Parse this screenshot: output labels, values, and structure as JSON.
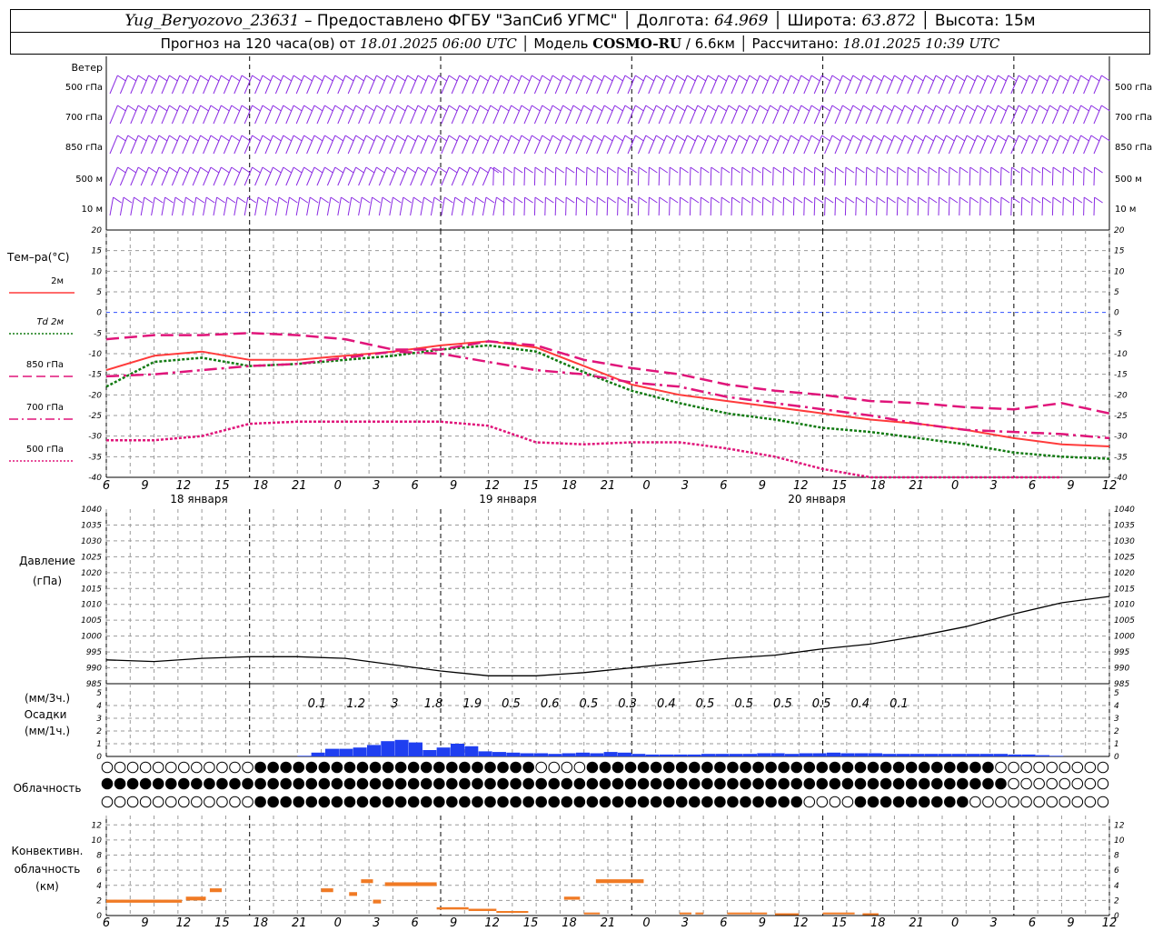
{
  "header": {
    "station": "Yug_Beryozovo_23631",
    "dash": " – Предоставлено ФГБУ \"ЗапСиб УГМС\" │ Долгота: ",
    "lon": "64.969",
    "lat_label": " │ Широта: ",
    "lat": "63.872",
    "alt_label": " │ Высота: 15м",
    "forecast_label": "Прогноз на 120 часа(ов) от ",
    "forecast_from": "18.01.2025 06:00 UTC",
    "model_label": "  │ Модель ",
    "model": "COSMO-RU",
    "res": " / 6.6км │ Рассчитано: ",
    "calc": "18.01.2025 10:39 UTC"
  },
  "time_axis": {
    "tick_labels": [
      "6",
      "9",
      "12",
      "15",
      "18",
      "21",
      "0",
      "3",
      "6",
      "9",
      "12",
      "15",
      "18",
      "21",
      "0",
      "3",
      "6",
      "9",
      "12",
      "15",
      "18",
      "21",
      "0",
      "3",
      "6",
      "9",
      "12"
    ],
    "day_labels": [
      "18 января",
      "19 января",
      "20 января"
    ]
  },
  "wind_panel": {
    "title": "Ветер",
    "levels": [
      "500 гПа",
      "700 гПа",
      "850 гПа",
      "500 м",
      "10  м"
    ],
    "color": "#8a2be2"
  },
  "temp_panel": {
    "title": "Тем–ра(°C)",
    "legend": [
      {
        "label": "2м",
        "color": "#ff3b3b",
        "style": "solid"
      },
      {
        "label": "Td  2м",
        "color": "#117a11",
        "style": "dotted"
      },
      {
        "label": "850 гПа",
        "color": "#e0157a",
        "style": "dash"
      },
      {
        "label": "700 гПа",
        "color": "#e0157a",
        "style": "dashdot"
      },
      {
        "label": "500 гПа",
        "color": "#e0157a",
        "style": "dotted"
      }
    ],
    "y_ticks": [
      "20",
      "15",
      "10",
      "5",
      "0",
      "-5",
      "-10",
      "-15",
      "-20",
      "-25",
      "-30",
      "-35",
      "-40"
    ]
  },
  "pressure_panel": {
    "title": "Давление",
    "unit": "(гПа)",
    "y_ticks": [
      "1040",
      "1035",
      "1030",
      "1025",
      "1020",
      "1015",
      "1010",
      "1005",
      "1000",
      "995",
      "990",
      "985"
    ]
  },
  "precip_panel": {
    "unit3": "(мм/3ч.)",
    "title": "Осадки",
    "unit1": "(мм/1ч.)",
    "y_ticks": [
      "5",
      "4",
      "3",
      "2",
      "1",
      "0"
    ],
    "totals_3h": [
      "0.1",
      "1.2",
      "3",
      "1.8",
      "1.9",
      "0.5",
      "0.6",
      "0.5",
      "0.3",
      "0.4",
      "0.5",
      "0.5",
      "0.5",
      "0.5",
      "0.4",
      "0.1"
    ],
    "color": "#1f3ff0"
  },
  "cloud_panel": {
    "title": "Облачность"
  },
  "conv_panel": {
    "title1": "Конвективн.",
    "title2": "облачность",
    "unit": "(км)",
    "y_ticks": [
      "12",
      "10",
      "8",
      "6",
      "4",
      "2",
      "0"
    ],
    "color": "#f07a24"
  },
  "chart_data": {
    "type": "line",
    "x_hours_from_start": "0..126 step 1 (start 18.01.2025 06 UTC)",
    "temperature": {
      "ylim": [
        -40,
        20
      ],
      "series": [
        {
          "name": "2м",
          "x": [
            0,
            6,
            12,
            18,
            24,
            30,
            36,
            42,
            48,
            54,
            60,
            66,
            72,
            78,
            84,
            90,
            96,
            102,
            108,
            114,
            120,
            126
          ],
          "values": [
            -14,
            -10.5,
            -9.5,
            -11.5,
            -11.5,
            -10.5,
            -9.5,
            -8,
            -7,
            -8.5,
            -13,
            -17.5,
            -20,
            -21.5,
            -23,
            -24.5,
            -26,
            -27,
            -28.5,
            -30.5,
            -32,
            -32.5
          ]
        },
        {
          "name": "Td 2м",
          "x": [
            0,
            6,
            12,
            18,
            24,
            30,
            36,
            42,
            48,
            54,
            60,
            66,
            72,
            78,
            84,
            90,
            96,
            102,
            108,
            114,
            120,
            126
          ],
          "values": [
            -18,
            -12,
            -11,
            -13,
            -12.5,
            -11.5,
            -10.5,
            -9,
            -8,
            -9.5,
            -14.5,
            -19,
            -22,
            -24.5,
            -26,
            -28,
            -29,
            -30.5,
            -32,
            -34,
            -35,
            -35.5
          ]
        },
        {
          "name": "850 гПа",
          "x": [
            0,
            6,
            12,
            18,
            24,
            30,
            36,
            42,
            48,
            54,
            60,
            66,
            72,
            78,
            84,
            90,
            96,
            102,
            108,
            114,
            120,
            126
          ],
          "values": [
            -6.5,
            -5.5,
            -5.5,
            -5,
            -5.5,
            -6.5,
            -9,
            -9,
            -7,
            -8,
            -11.5,
            -13.5,
            -15,
            -17.5,
            -19,
            -20,
            -21.5,
            -22,
            -23,
            -23.5,
            -22,
            -24.5
          ]
        },
        {
          "name": "700 гПа",
          "x": [
            0,
            6,
            12,
            18,
            24,
            30,
            36,
            42,
            48,
            54,
            60,
            66,
            72,
            78,
            84,
            90,
            96,
            102,
            108,
            114,
            120,
            126
          ],
          "values": [
            -15.5,
            -15,
            -14,
            -13,
            -12.5,
            -11,
            -9.5,
            -10,
            -12,
            -14,
            -15,
            -17,
            -18,
            -20.5,
            -22,
            -23.5,
            -25,
            -27,
            -28.5,
            -29,
            -29.5,
            -30.5
          ]
        },
        {
          "name": "500 гПа",
          "x": [
            0,
            6,
            12,
            18,
            24,
            30,
            36,
            42,
            48,
            54,
            60,
            66,
            72,
            78,
            84,
            90,
            96,
            102,
            108,
            114,
            120
          ],
          "values": [
            -31,
            -31,
            -30,
            -27,
            -26.5,
            -26.5,
            -26.5,
            -26.5,
            -27.5,
            -31.5,
            -32,
            -31.5,
            -31.5,
            -33,
            -35,
            -38,
            -40,
            -40,
            -40,
            -40,
            -40
          ]
        }
      ]
    },
    "pressure": {
      "ylim": [
        985,
        1040
      ],
      "x": [
        0,
        6,
        12,
        18,
        24,
        30,
        36,
        42,
        48,
        54,
        60,
        66,
        72,
        78,
        84,
        90,
        96,
        102,
        108,
        114,
        120,
        126
      ],
      "values": [
        992.5,
        992,
        993,
        993.5,
        993.5,
        993,
        991,
        989,
        987.5,
        987.5,
        988.5,
        990,
        991.5,
        993,
        994,
        996,
        997.5,
        1000,
        1003,
        1007,
        1010.5,
        1012.5
      ]
    },
    "precip_1h": {
      "ylim": [
        0,
        5
      ],
      "x_start": 24,
      "values": [
        0.05,
        0.3,
        0.6,
        0.6,
        0.7,
        0.9,
        1.2,
        1.3,
        1.1,
        0.5,
        0.7,
        1,
        0.8,
        0.4,
        0.35,
        0.3,
        0.25,
        0.25,
        0.2,
        0.25,
        0.3,
        0.25,
        0.35,
        0.3,
        0.2,
        0.15,
        0.15,
        0.15,
        0.15,
        0.2,
        0.2,
        0.2,
        0.2,
        0.25,
        0.25,
        0.2,
        0.25,
        0.25,
        0.3,
        0.25,
        0.25,
        0.25,
        0.2,
        0.2,
        0.2,
        0.2,
        0.2,
        0.2,
        0.2,
        0.2,
        0.2,
        0.15,
        0.15,
        0.1,
        0.05
      ]
    },
    "convective_cloud_km": {
      "ylim": [
        0,
        13
      ],
      "segments": [
        {
          "x0": 0,
          "x1": 9.5,
          "base": 1.7,
          "top": 2.1
        },
        {
          "x0": 10,
          "x1": 12.5,
          "base": 2.0,
          "top": 2.5
        },
        {
          "x0": 13,
          "x1": 14.5,
          "base": 3.1,
          "top": 3.6
        },
        {
          "x0": 27,
          "x1": 28.5,
          "base": 3.1,
          "top": 3.6
        },
        {
          "x0": 30.5,
          "x1": 31.5,
          "base": 2.6,
          "top": 3.1
        },
        {
          "x0": 32,
          "x1": 33.5,
          "base": 4.3,
          "top": 4.8
        },
        {
          "x0": 33.5,
          "x1": 34.5,
          "base": 1.6,
          "top": 2.1
        },
        {
          "x0": 35,
          "x1": 41.5,
          "base": 3.9,
          "top": 4.4
        },
        {
          "x0": 41.5,
          "x1": 45.5,
          "base": 0.8,
          "top": 1.1
        },
        {
          "x0": 45.5,
          "x1": 49,
          "base": 0.6,
          "top": 0.9
        },
        {
          "x0": 49,
          "x1": 53,
          "base": 0.4,
          "top": 0.6
        },
        {
          "x0": 57.5,
          "x1": 59.5,
          "base": 2.1,
          "top": 2.5
        },
        {
          "x0": 60,
          "x1": 62,
          "base": 0.2,
          "top": 0.4
        },
        {
          "x0": 61.5,
          "x1": 67.5,
          "base": 4.3,
          "top": 4.8
        },
        {
          "x0": 72,
          "x1": 73.5,
          "base": 0.2,
          "top": 0.4
        },
        {
          "x0": 74,
          "x1": 75,
          "base": 0.2,
          "top": 0.4
        },
        {
          "x0": 78,
          "x1": 83,
          "base": 0.2,
          "top": 0.4
        },
        {
          "x0": 84,
          "x1": 87,
          "base": 0.1,
          "top": 0.3
        },
        {
          "x0": 90,
          "x1": 94,
          "base": 0.2,
          "top": 0.4
        },
        {
          "x0": 95,
          "x1": 97,
          "base": 0.1,
          "top": 0.3
        }
      ]
    }
  }
}
